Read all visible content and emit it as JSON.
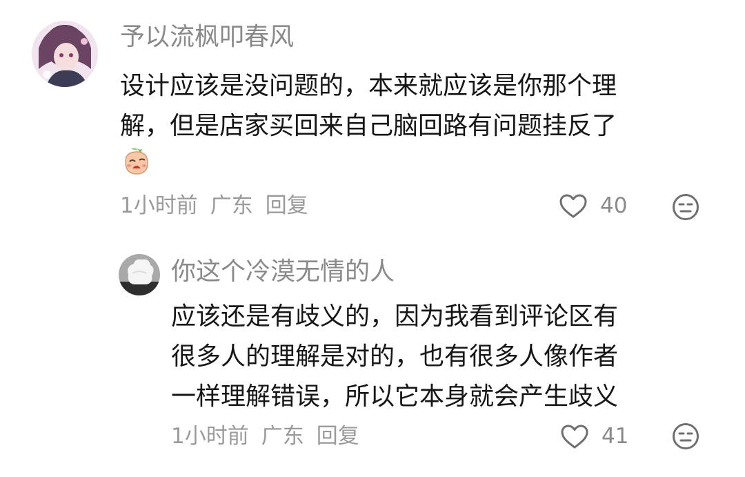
{
  "comments": [
    {
      "username": "予以流枫叩春风",
      "text_line1": "设计应该是没问题的，本来就应该是你那个理",
      "text_line2": "解，但是店家买回来自己脑回路有问题挂反了",
      "emoji": "peach-crying-emoji",
      "time": "1小时前",
      "location": "广东",
      "reply_label": "回复",
      "likes": "40"
    },
    {
      "username": "你这个冷漠无情的人",
      "text_line1": "应该还是有歧义的，因为我看到评论区有",
      "text_line2": "很多人的理解是对的，也有很多人像作者",
      "text_line3": "一样理解错误，所以它本身就会产生歧义",
      "time": "1小时前",
      "location": "广东",
      "reply_label": "回复",
      "likes": "41"
    }
  ],
  "icons": {
    "like": "heart-outline-icon",
    "dislike": "neutral-face-icon"
  },
  "colors": {
    "username": "#8a8a8a",
    "text": "#161616",
    "meta": "#9a9a9a",
    "icon": "#6f6f6f"
  }
}
